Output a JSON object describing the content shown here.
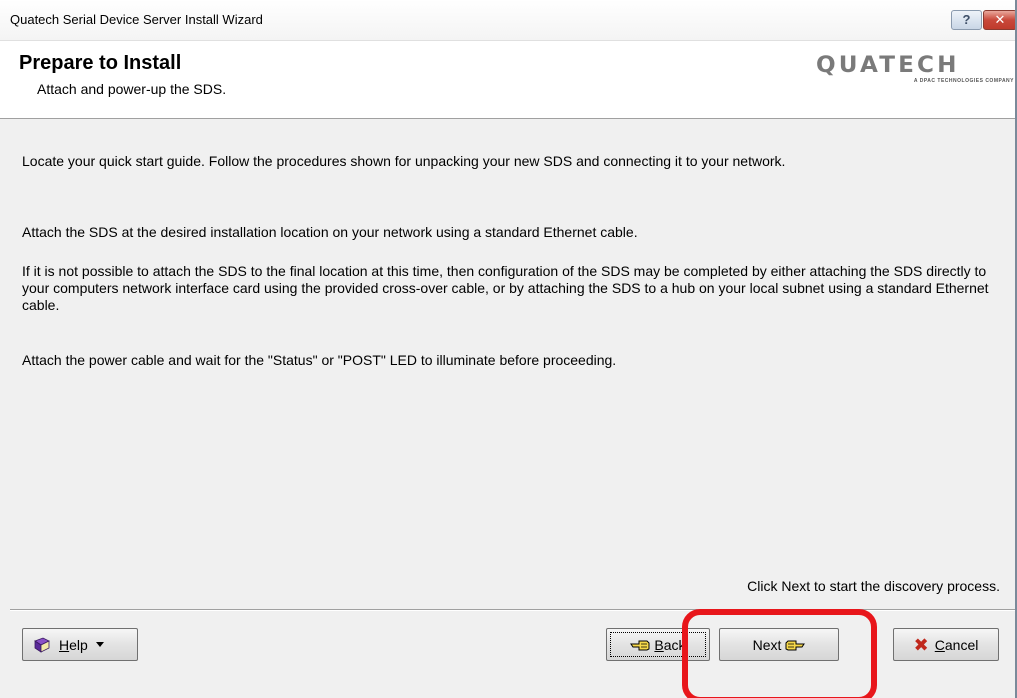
{
  "window": {
    "title": "Quatech Serial Device Server Install Wizard",
    "help_glyph": "?",
    "close_glyph": "✕"
  },
  "header": {
    "title": "Prepare to Install",
    "subtitle": "Attach and power-up the SDS.",
    "logo_word": "QUATECH",
    "logo_tagline": "A DPAC TECHNOLOGIES COMPANY"
  },
  "content": {
    "paragraphs": [
      "Locate your quick start guide.  Follow the procedures shown for unpacking your new SDS and connecting it to your network.",
      "Attach the SDS at the desired installation location on your network using a standard Ethernet cable.",
      "If it is not possible to attach the SDS to the final location at this time, then configuration of the SDS may be completed by either attaching the SDS directly to your computers network interface card using the provided cross-over cable, or by attaching the SDS to a hub on your local subnet using a standard Ethernet cable.",
      "Attach the power cable and wait for the \"Status\" or \"POST\" LED to illuminate before proceeding."
    ],
    "hint": "Click Next to start the discovery process."
  },
  "footer": {
    "help_label": "Help",
    "back_label": "Back",
    "next_label": "Next",
    "cancel_label": "Cancel"
  },
  "colors": {
    "highlight": "#e8161b",
    "cancel_x": "#c0281c",
    "window_bg": "#f0f0f0"
  },
  "icons": {
    "help": "book-icon",
    "back": "hand-pointing-left-icon",
    "next": "hand-pointing-right-icon",
    "cancel": "red-x-icon"
  }
}
